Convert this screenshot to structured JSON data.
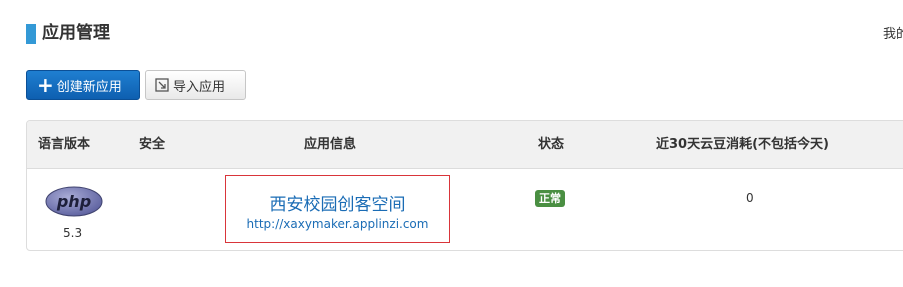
{
  "header": {
    "title": "应用管理",
    "right_text": "我的"
  },
  "toolbar": {
    "create_label": "创建新应用",
    "import_label": "导入应用"
  },
  "table": {
    "columns": [
      "语言版本",
      "安全",
      "应用信息",
      "状态",
      "近30天云豆消耗(不包括今天)"
    ],
    "rows": [
      {
        "language_logo": "php",
        "language_version": "5.3",
        "security": "",
        "app_name": "西安校园创客空间",
        "app_url": "http://xaxymaker.applinzi.com",
        "status": "正常",
        "consumption": "0"
      }
    ]
  },
  "colors": {
    "accent": "#3399d6",
    "primary_button": "#0e5fb0",
    "link": "#1a6cb5",
    "status_ok": "#4a8f42",
    "highlight_border": "#d9353a"
  }
}
